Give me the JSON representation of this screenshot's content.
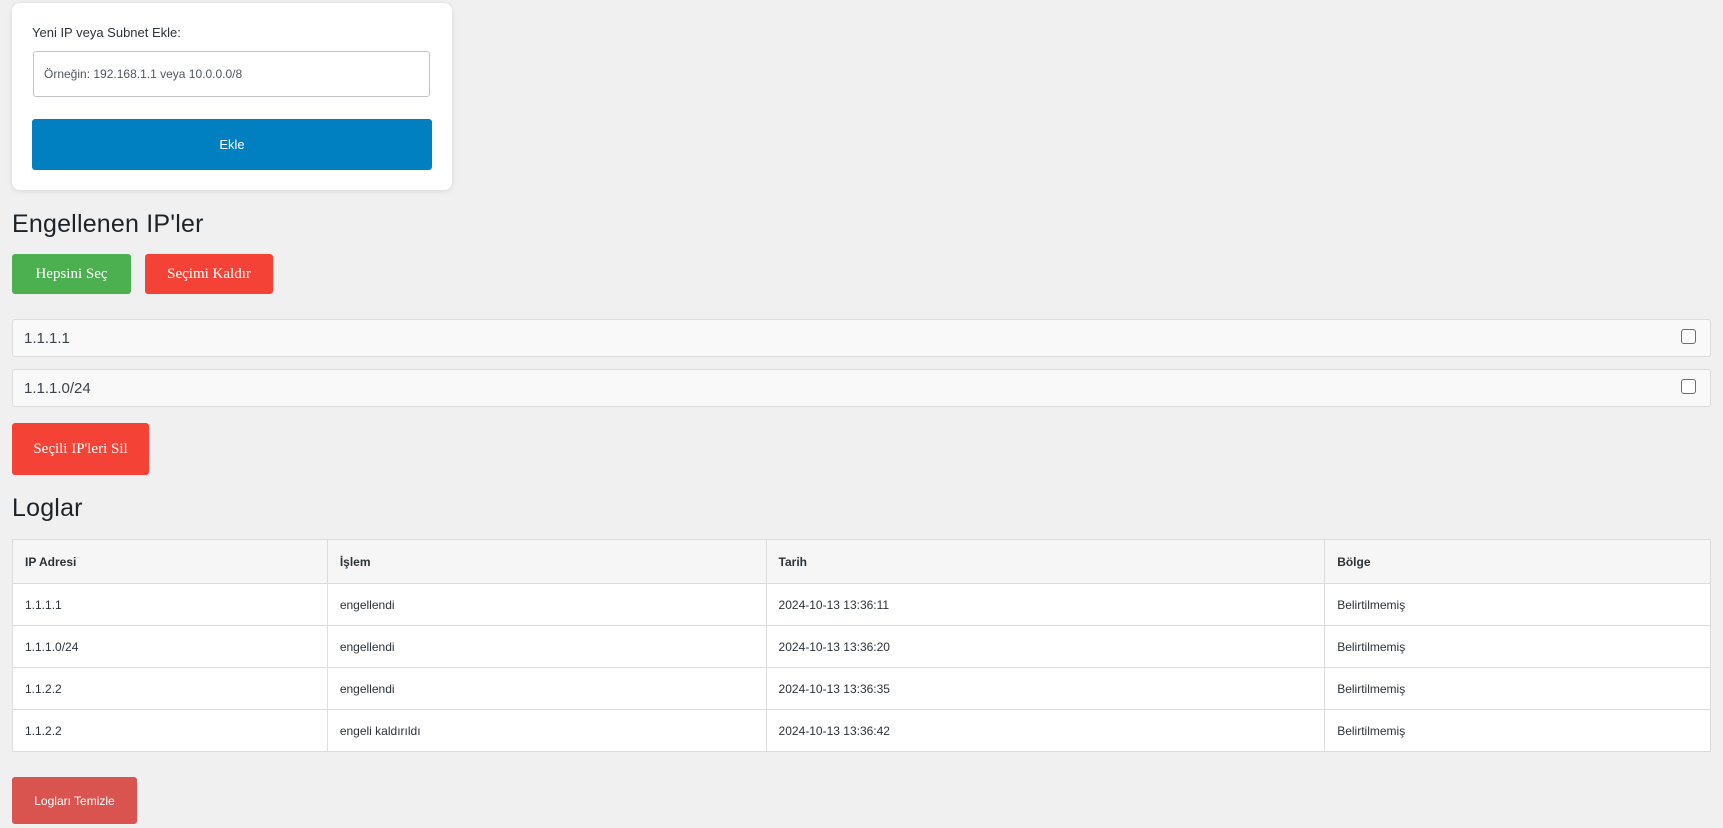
{
  "add_form": {
    "label": "Yeni IP veya Subnet Ekle:",
    "input_value": "",
    "input_placeholder": "Örneğin: 192.168.1.1 veya 10.0.0.0/8",
    "submit_label": "Ekle"
  },
  "blocked": {
    "title": "Engellenen IP'ler",
    "select_all_label": "Hepsini Seç",
    "deselect_label": "Seçimi Kaldır",
    "items": [
      {
        "ip": "1.1.1.1",
        "checked": false
      },
      {
        "ip": "1.1.1.0/24",
        "checked": false
      }
    ],
    "delete_selected_label": "Seçili IP'leri Sil"
  },
  "logs": {
    "title": "Loglar",
    "columns": [
      "IP Adresi",
      "İşlem",
      "Tarih",
      "Bölge"
    ],
    "rows": [
      [
        "1.1.1.1",
        "engellendi",
        "2024-10-13 13:36:11",
        "Belirtilmemiş"
      ],
      [
        "1.1.1.0/24",
        "engellendi",
        "2024-10-13 13:36:20",
        "Belirtilmemiş"
      ],
      [
        "1.1.2.2",
        "engellendi",
        "2024-10-13 13:36:35",
        "Belirtilmemiş"
      ],
      [
        "1.1.2.2",
        "engeli kaldırıldı",
        "2024-10-13 13:36:42",
        "Belirtilmemiş"
      ]
    ],
    "clear_label": "Logları Temizle"
  },
  "colors": {
    "page_bg": "#f0f0f1",
    "primary_blue": "#0080c0",
    "green": "#4caf50",
    "red": "#f44336",
    "soft_red": "#d9534f"
  },
  "icons": {
    "checkbox": "checkbox-icon"
  }
}
